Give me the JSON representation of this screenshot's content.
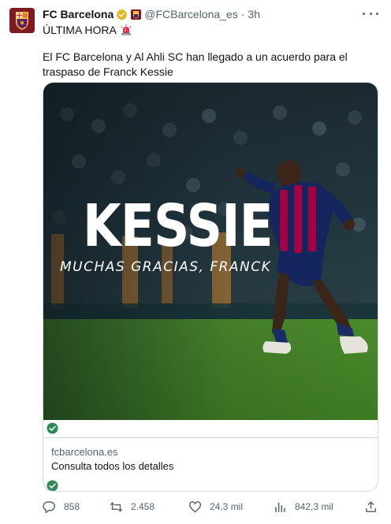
{
  "tweet": {
    "author": {
      "display_name": "FC Barcelona",
      "handle": "@FCBarcelona_es",
      "time": "3h",
      "separator": "·"
    },
    "line1": "ÚLTIMA HORA",
    "text": "El FC Barcelona y Al Ahli SC han llegado a un acuerdo para el traspaso de Franck Kessie",
    "card": {
      "image_title": "KESSIE",
      "image_subtitle": "MUCHAS GRACIAS, FRANCK",
      "domain": "fcbarcelona.es",
      "description": "Consulta todos los detalles"
    },
    "actions": {
      "replies": "858",
      "retweets": "2.458",
      "likes": "24,3 mil",
      "views": "842,3 mil"
    }
  },
  "colors": {
    "text_primary": "#0f1419",
    "text_secondary": "#536471",
    "border": "#cfd9de",
    "verified": "#e2b719",
    "check_green": "#2e8a57"
  },
  "icons": [
    "fcb-crest-icon",
    "verified-badge-icon",
    "affiliate-badge-icon",
    "more-icon",
    "siren-icon",
    "check-icon",
    "reply-icon",
    "retweet-icon",
    "like-icon",
    "views-icon",
    "share-icon"
  ]
}
